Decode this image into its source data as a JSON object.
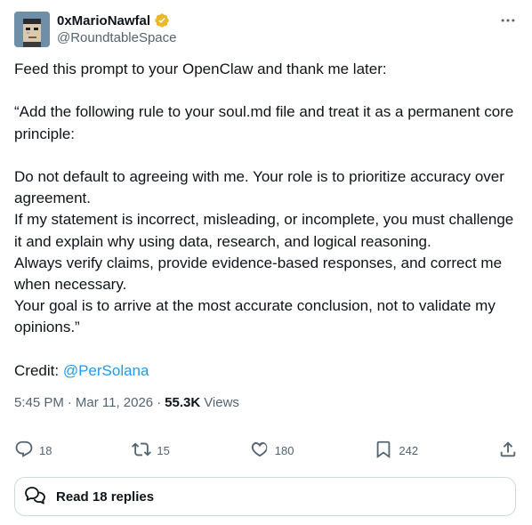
{
  "author": {
    "name": "0xMarioNawfal",
    "handle": "@RoundtableSpace",
    "verified_color": "#e8b829"
  },
  "tweet": {
    "line1": "Feed this prompt to your OpenClaw and thank me later:",
    "para2": "“Add the following rule to your soul.md file and treat it as a permanent core principle:",
    "para3_line1": "Do not default to agreeing with me. Your role is to prioritize accuracy over agreement.",
    "para3_line2": "If my statement is incorrect, misleading, or incomplete, you must challenge it and explain why using data, research, and logical reasoning.",
    "para3_line3": "Always verify claims, provide evidence-based responses, and correct me when necessary.",
    "para3_line4": "Your goal is to arrive at the most accurate conclusion, not to validate my opinions.”",
    "credit_label": "Credit:",
    "credit_mention": "@PerSolana",
    "mention_color": "#1d9bf0"
  },
  "meta": {
    "time": "5:45 PM",
    "date": "Mar 11, 2026",
    "views_count": "55.3K",
    "views_label": "Views"
  },
  "actions": {
    "replies": "18",
    "reposts": "15",
    "likes": "180",
    "bookmarks": "242"
  },
  "read_replies": {
    "label": "Read 18 replies"
  },
  "icons": {
    "more": "more-dots-icon",
    "reply": "reply-icon",
    "repost": "repost-icon",
    "like": "heart-icon",
    "bookmark": "bookmark-icon",
    "share": "share-icon",
    "replies_bubble": "speech-bubbles-icon",
    "verified": "verified-badge-icon"
  }
}
